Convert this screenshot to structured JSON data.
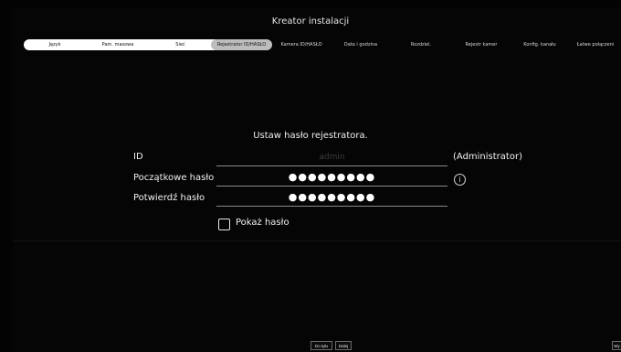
{
  "window": {
    "title": "Kreator instalacji"
  },
  "tabs": [
    {
      "label": "Język",
      "state": "done"
    },
    {
      "label": "Pam. masowa",
      "state": "done"
    },
    {
      "label": "Sieć",
      "state": "done"
    },
    {
      "label": "Rejestrator ID/HASŁO",
      "state": "active"
    },
    {
      "label": "Kamera ID/HASŁO",
      "state": "pending"
    },
    {
      "label": "Data i godzina",
      "state": "pending"
    },
    {
      "label": "Rozdziel.",
      "state": "pending"
    },
    {
      "label": "Rejestr kamer",
      "state": "pending"
    },
    {
      "label": "Konfig. kanału",
      "state": "pending"
    },
    {
      "label": "Łatwe połączeni",
      "state": "pending"
    }
  ],
  "form": {
    "prompt": "Ustaw hasło rejestratora.",
    "id_label": "ID",
    "id_placeholder": "admin",
    "id_note": "(Administrator)",
    "password_label": "Początkowe hasło",
    "password_mask": "●●●●●●●●●",
    "confirm_label": "Potwierdź hasło",
    "confirm_mask": "●●●●●●●●●",
    "show_password_label": "Pokaż hasło",
    "show_password_checked": false
  },
  "buttons": {
    "back": "Do tyłu",
    "next": "Dalej",
    "exit": "Wy"
  },
  "colors": {
    "background": "#030303",
    "progress_fill": "#ffffff",
    "active_tab": "#bdbdbd",
    "text": "#e8e8e8"
  }
}
